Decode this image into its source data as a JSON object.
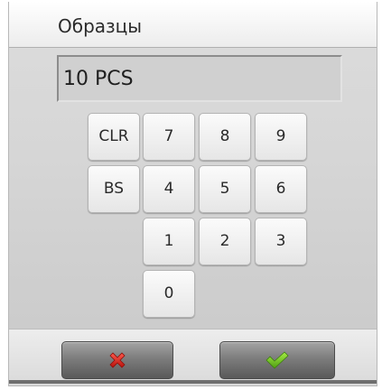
{
  "title": "Образцы",
  "display": {
    "value": "10 PCS"
  },
  "keypad": {
    "clr": "CLR",
    "bs": "BS",
    "k7": "7",
    "k8": "8",
    "k9": "9",
    "k4": "4",
    "k5": "5",
    "k6": "6",
    "k1": "1",
    "k2": "2",
    "k3": "3",
    "k0": "0"
  },
  "actions": {
    "cancel_icon": "cross-icon",
    "confirm_icon": "check-icon",
    "cancel_color": "#d9231c",
    "confirm_color": "#6cc21d"
  }
}
